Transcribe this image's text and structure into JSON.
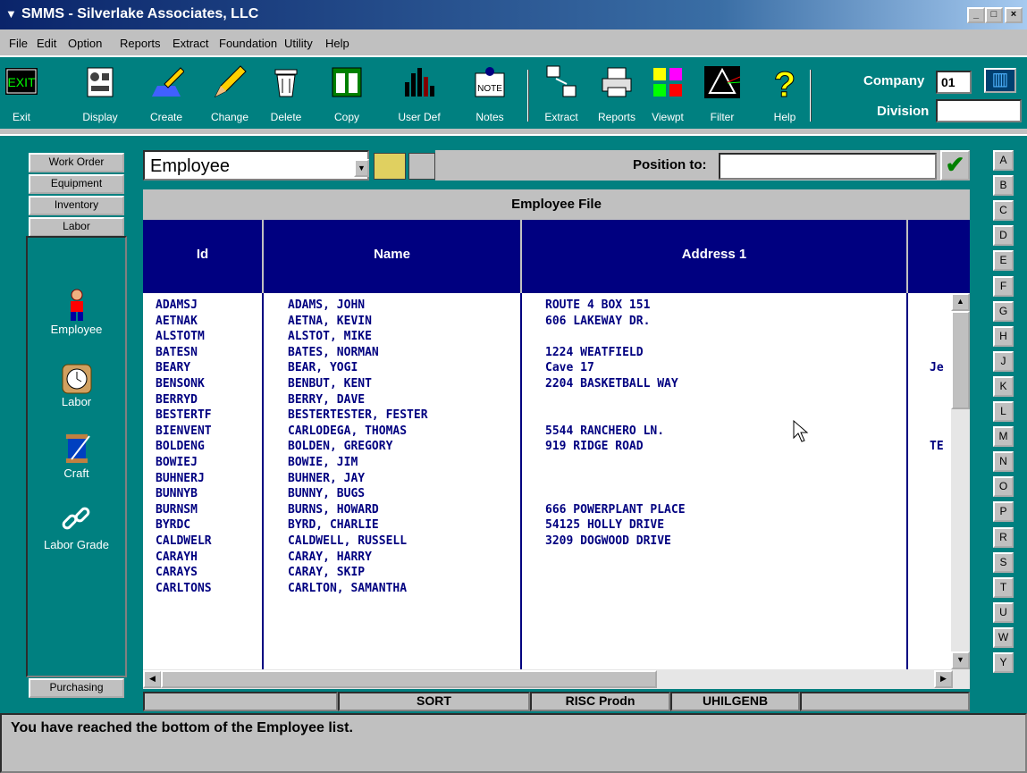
{
  "window": {
    "title": "SMMS - Silverlake Associates, LLC",
    "min": "_",
    "max": "□",
    "close": "×"
  },
  "menu": [
    "File",
    "Edit",
    "Option",
    "Reports",
    "Extract",
    "Foundation",
    "Utility",
    "Help"
  ],
  "toolbar": {
    "exit": "Exit",
    "exit_icon_text": "EXIT",
    "display": "Display",
    "create": "Create",
    "change": "Change",
    "delete": "Delete",
    "copy": "Copy",
    "userdef": "User Def",
    "notes": "Notes",
    "notes_icon_text": "NOTE",
    "extract": "Extract",
    "reports": "Reports",
    "viewpt": "Viewpt",
    "filter": "Filter",
    "help": "Help"
  },
  "company": {
    "label": "Company",
    "value": "01",
    "division_label": "Division",
    "division_value": ""
  },
  "nav": {
    "tabs": [
      "Work Order",
      "Equipment",
      "Inventory",
      "Labor"
    ],
    "items": [
      "Employee",
      "Labor",
      "Craft",
      "Labor Grade"
    ],
    "bottom_tab": "Purchasing"
  },
  "file_select": {
    "value": "Employee",
    "position_label": "Position to:",
    "position_value": ""
  },
  "grid": {
    "title": "Employee File",
    "columns": [
      "Id",
      "Name",
      "Address 1"
    ],
    "rows": [
      {
        "id": "ADAMSJ",
        "name": "ADAMS, JOHN",
        "addr": "ROUTE 4 BOX 151",
        "extra": ""
      },
      {
        "id": "AETNAK",
        "name": "AETNA, KEVIN",
        "addr": "606 LAKEWAY DR.",
        "extra": ""
      },
      {
        "id": "ALSTOTM",
        "name": "ALSTOT, MIKE",
        "addr": "",
        "extra": ""
      },
      {
        "id": "BATESN",
        "name": "BATES, NORMAN",
        "addr": "1224 WEATFIELD",
        "extra": ""
      },
      {
        "id": "BEARY",
        "name": "BEAR, YOGI",
        "addr": "Cave 17",
        "extra": "Je"
      },
      {
        "id": "BENSONK",
        "name": "BENBUT, KENT",
        "addr": "2204 BASKETBALL WAY",
        "extra": ""
      },
      {
        "id": "BERRYD",
        "name": "BERRY, DAVE",
        "addr": "",
        "extra": ""
      },
      {
        "id": "BESTERTF",
        "name": "BESTERTESTER, FESTER",
        "addr": "",
        "extra": ""
      },
      {
        "id": "BIENVENT",
        "name": "CARLODEGA, THOMAS",
        "addr": "5544 RANCHERO LN.",
        "extra": ""
      },
      {
        "id": "BOLDENG",
        "name": "BOLDEN, GREGORY",
        "addr": "919 RIDGE ROAD",
        "extra": "TE"
      },
      {
        "id": "BOWIEJ",
        "name": "BOWIE, JIM",
        "addr": "",
        "extra": ""
      },
      {
        "id": "BUHNERJ",
        "name": "BUHNER, JAY",
        "addr": "",
        "extra": ""
      },
      {
        "id": "BUNNYB",
        "name": "BUNNY, BUGS",
        "addr": "",
        "extra": ""
      },
      {
        "id": "BURNSM",
        "name": "BURNS, HOWARD",
        "addr": "666 POWERPLANT PLACE",
        "extra": ""
      },
      {
        "id": "BYRDC",
        "name": "BYRD, CHARLIE",
        "addr": "54125 HOLLY DRIVE",
        "extra": ""
      },
      {
        "id": "CALDWELR",
        "name": "CALDWELL, RUSSELL",
        "addr": "3209 DOGWOOD DRIVE",
        "extra": ""
      },
      {
        "id": "CARAYH",
        "name": "CARAY, HARRY",
        "addr": "",
        "extra": ""
      },
      {
        "id": "CARAYS",
        "name": "CARAY, SKIP",
        "addr": "",
        "extra": ""
      },
      {
        "id": "CARLTONS",
        "name": "CARLTON, SAMANTHA",
        "addr": "",
        "extra": ""
      }
    ]
  },
  "status": {
    "sort": "SORT",
    "env": "RISC Prodn",
    "user": "UHILGENB"
  },
  "alphabet": [
    "A",
    "B",
    "C",
    "D",
    "E",
    "F",
    "G",
    "H",
    "J",
    "K",
    "L",
    "M",
    "N",
    "O",
    "P",
    "R",
    "S",
    "T",
    "U",
    "W",
    "Y"
  ],
  "message": "You have reached the bottom of the Employee  list.",
  "colors": {
    "teal": "#008080",
    "navy": "#000080",
    "gray": "#c0c0c0"
  }
}
